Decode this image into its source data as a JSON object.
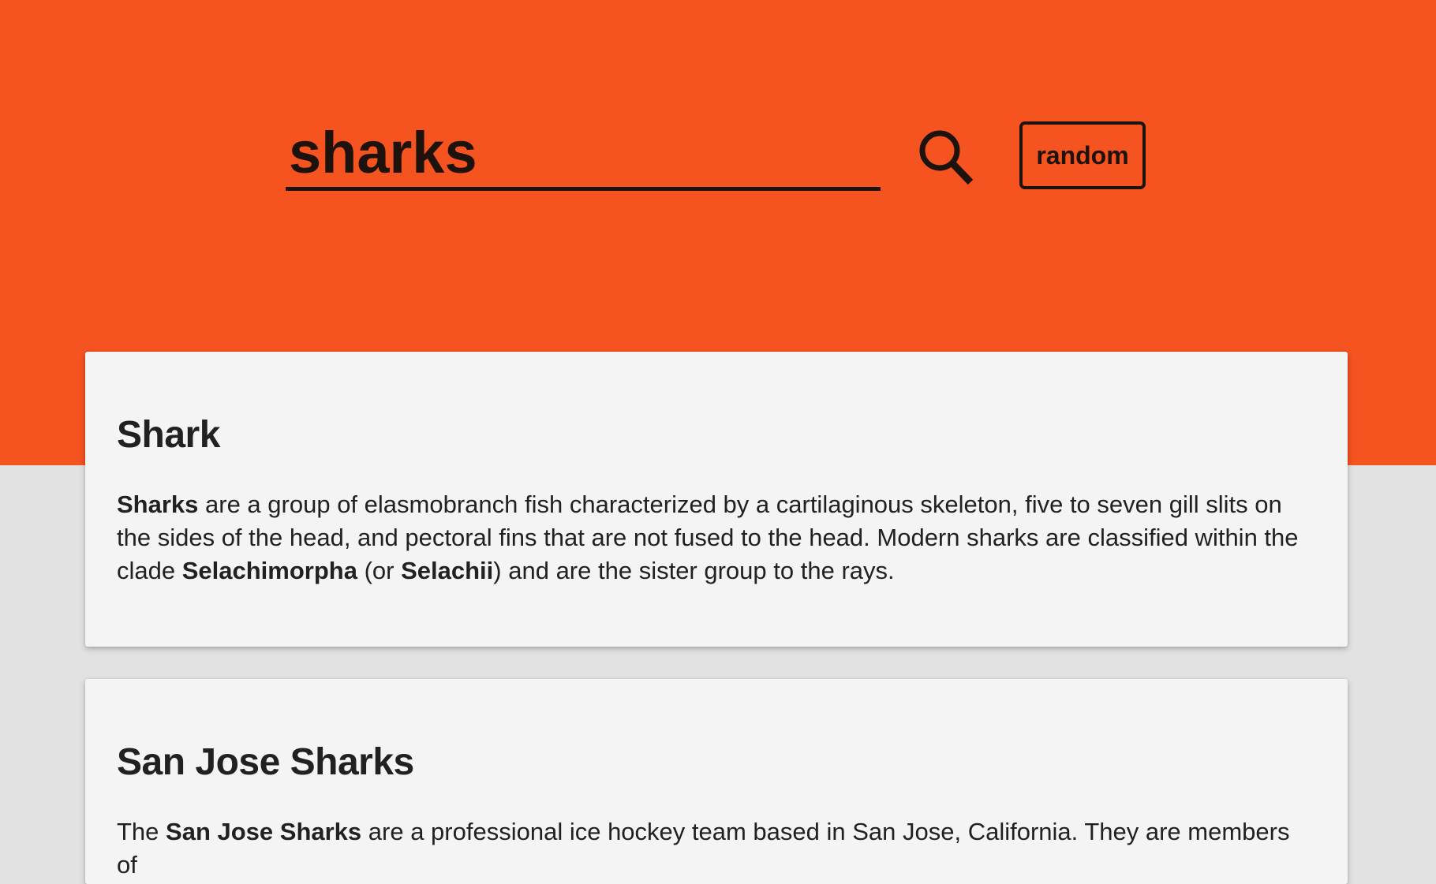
{
  "search": {
    "value": "sharks",
    "random_label": "random"
  },
  "icons": {
    "search": "search-icon"
  },
  "colors": {
    "accent": "#f55320",
    "background": "#e2e2e2",
    "card": "#f4f4f4",
    "text": "#212121"
  },
  "results": [
    {
      "title": "Shark",
      "snippet": [
        {
          "text": "Sharks",
          "bold": true
        },
        {
          "text": " are a group of elasmobranch fish characterized by a cartilaginous skeleton, five to seven gill slits on the sides of the head, and pectoral fins that are not fused to the head. Modern sharks are classified within the clade ",
          "bold": false
        },
        {
          "text": "Selachimorpha",
          "bold": true
        },
        {
          "text": " (or ",
          "bold": false
        },
        {
          "text": "Selachii",
          "bold": true
        },
        {
          "text": ") and are the sister group to the rays.",
          "bold": false
        }
      ]
    },
    {
      "title": "San Jose Sharks",
      "snippet": [
        {
          "text": "The ",
          "bold": false
        },
        {
          "text": "San Jose Sharks",
          "bold": true
        },
        {
          "text": " are a professional ice hockey team based in San Jose, California. They are members of",
          "bold": false
        }
      ]
    }
  ]
}
